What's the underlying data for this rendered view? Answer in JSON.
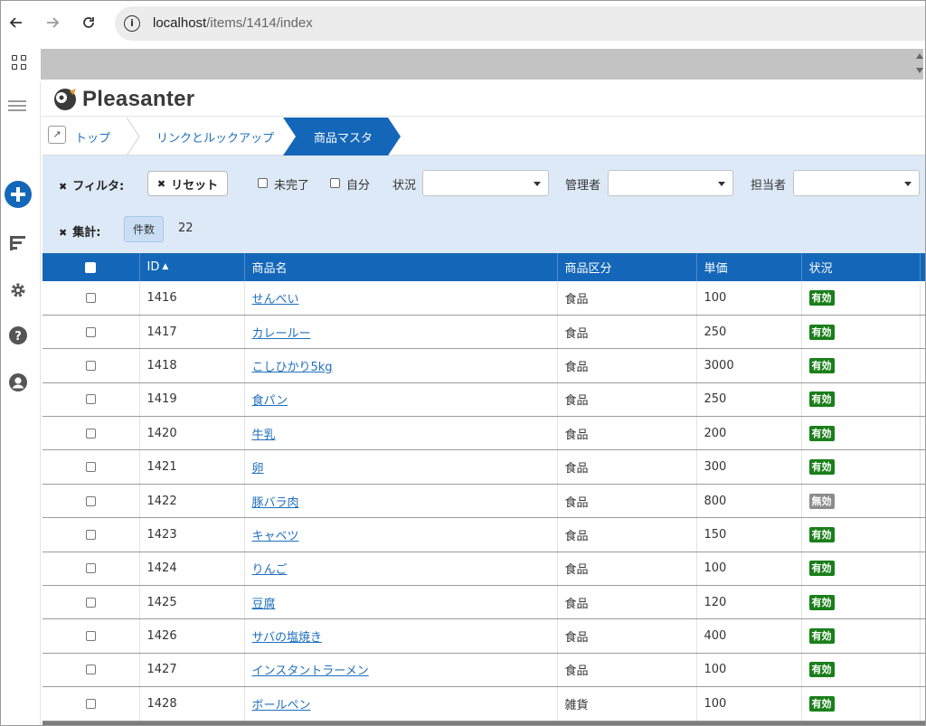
{
  "browser": {
    "url_host": "localhost",
    "url_path": "/items/1414/index"
  },
  "app": {
    "logo_text": "Pleasanter"
  },
  "breadcrumb": {
    "home": "トップ",
    "parent": "リンクとルックアップ",
    "current": "商品マスタ"
  },
  "filters": {
    "filter_label": "フィルタ:",
    "reset_label": "リセット",
    "incomplete_label": "未完了",
    "own_label": "自分",
    "status_label": "状況",
    "manager_label": "管理者",
    "owner_label": "担当者",
    "aggregate_label": "集計:",
    "count_label": "件数",
    "count_value": "22"
  },
  "table": {
    "columns": [
      "ID",
      "商品名",
      "商品区分",
      "単価",
      "状況"
    ],
    "rows": [
      {
        "id": "1416",
        "name": "せんべい",
        "category": "食品",
        "price": "100",
        "status": "有効"
      },
      {
        "id": "1417",
        "name": "カレールー",
        "category": "食品",
        "price": "250",
        "status": "有効"
      },
      {
        "id": "1418",
        "name": "こしひかり5kg",
        "category": "食品",
        "price": "3000",
        "status": "有効"
      },
      {
        "id": "1419",
        "name": "食パン",
        "category": "食品",
        "price": "250",
        "status": "有効"
      },
      {
        "id": "1420",
        "name": "牛乳",
        "category": "食品",
        "price": "200",
        "status": "有効"
      },
      {
        "id": "1421",
        "name": "卵",
        "category": "食品",
        "price": "300",
        "status": "有効"
      },
      {
        "id": "1422",
        "name": "豚バラ肉",
        "category": "食品",
        "price": "800",
        "status": "無効"
      },
      {
        "id": "1423",
        "name": "キャベツ",
        "category": "食品",
        "price": "150",
        "status": "有効"
      },
      {
        "id": "1424",
        "name": "りんご",
        "category": "食品",
        "price": "100",
        "status": "有効"
      },
      {
        "id": "1425",
        "name": "豆腐",
        "category": "食品",
        "price": "120",
        "status": "有効"
      },
      {
        "id": "1426",
        "name": "サバの塩焼き",
        "category": "食品",
        "price": "400",
        "status": "有効"
      },
      {
        "id": "1427",
        "name": "インスタントラーメン",
        "category": "食品",
        "price": "100",
        "status": "有効"
      },
      {
        "id": "1428",
        "name": "ボールペン",
        "category": "雑貨",
        "price": "100",
        "status": "有効"
      }
    ]
  },
  "colors": {
    "header_blue": "#1467b8",
    "filter_bg": "#dde9f7",
    "status_active": "#1a7f1a",
    "status_inactive": "#8c8c8c",
    "link": "#1e6fbd"
  },
  "icons": [
    "back-icon",
    "forward-icon",
    "reload-icon",
    "site-info-icon",
    "apps-grid-icon",
    "menu-icon",
    "add-icon",
    "sort-icon",
    "gear-icon",
    "help-icon",
    "user-icon",
    "link-icon"
  ]
}
